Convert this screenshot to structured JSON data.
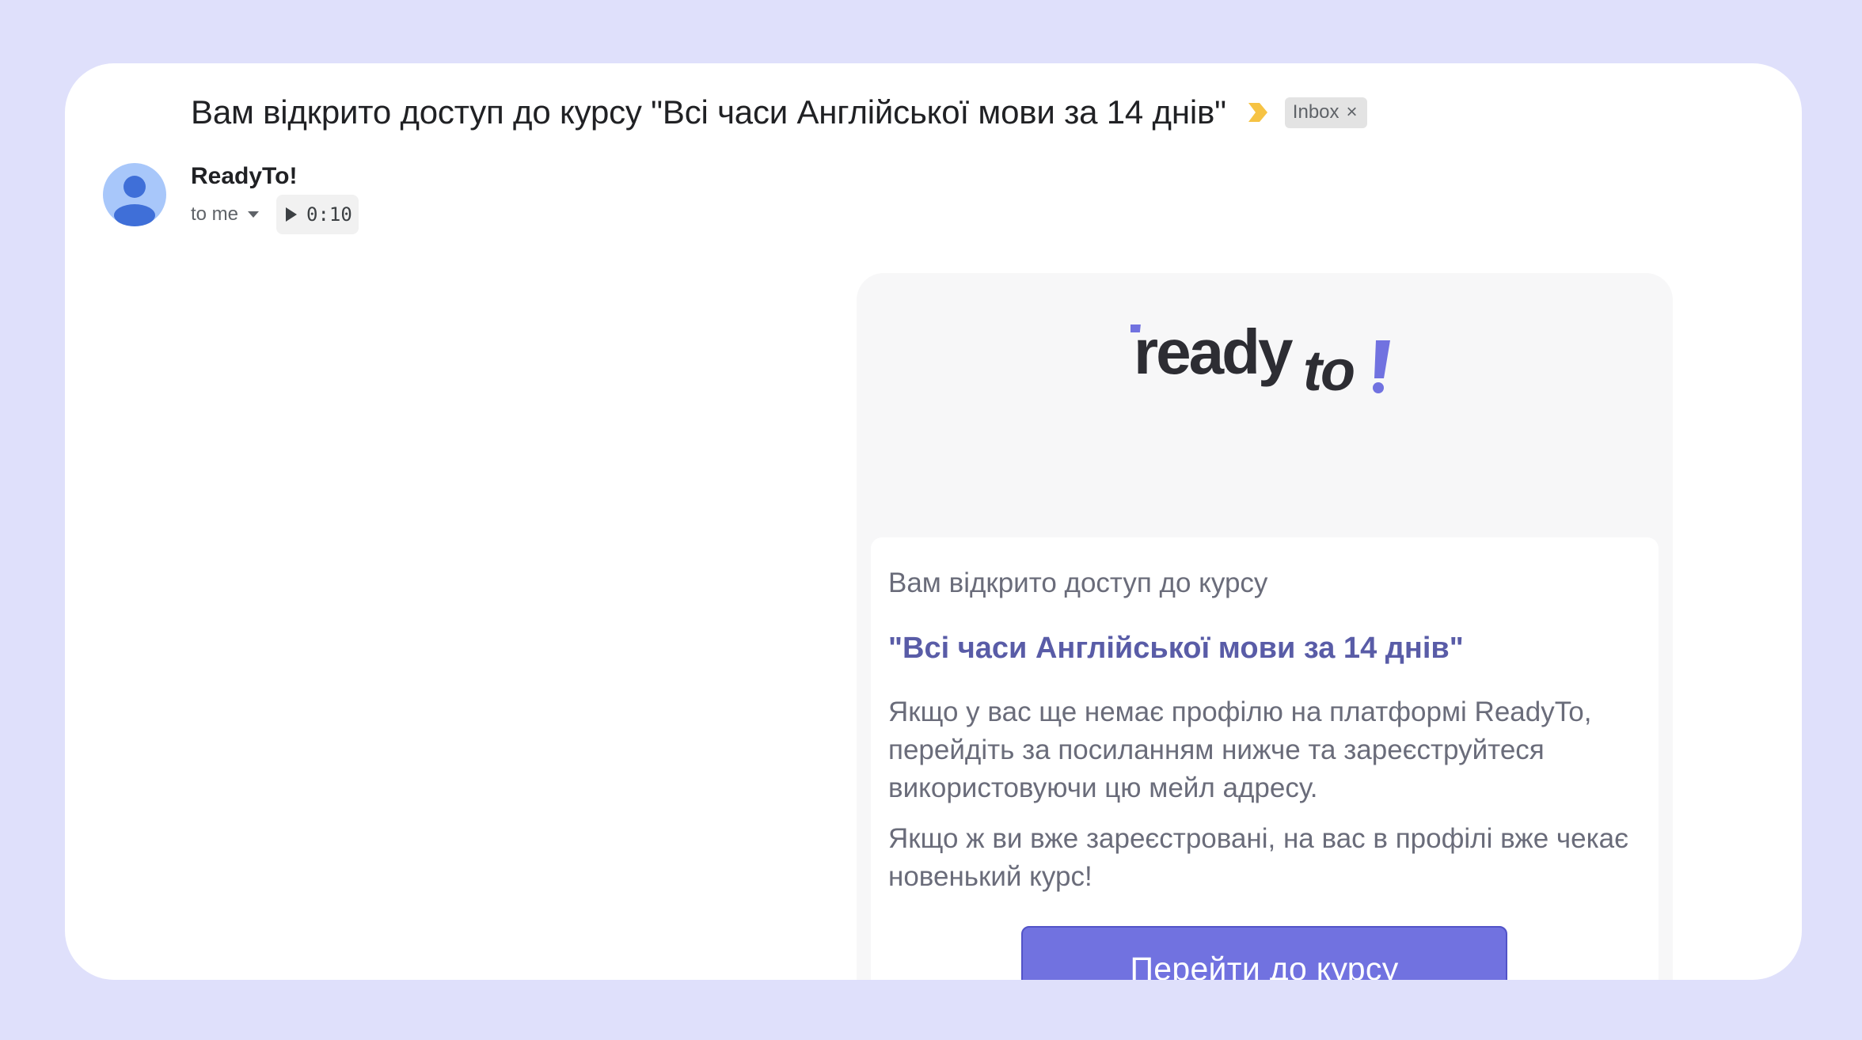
{
  "header": {
    "subject": "Вам відкрито доступ до курсу \"Всі часи Англійської мови за 14 днів\"",
    "label_chip": "Inbox",
    "label_remove": "×"
  },
  "message": {
    "sender": "ReadyTo!",
    "recipient": "to me",
    "audio_duration": "0:10"
  },
  "email_body": {
    "logo_text_main": "ready",
    "logo_text_secondary": "to",
    "intro": "Вам відкрито доступ до курсу",
    "course_title": "\"Всі часи Англійської мови за 14 днів\"",
    "paragraph_1": "Якщо у вас ще немає профілю на платформі ReadyTo, перейдіть за посиланням нижче та зареєструйтеся використовуючи цю мейл адресу.",
    "paragraph_2": "Якщо ж ви вже зареєстровані, на вас в профілі вже чекає новенький курс!",
    "cta_label": "Перейти до курсу"
  },
  "colors": {
    "page_background": "#dfe0fb",
    "brand_purple": "#7172e0",
    "course_title": "#595ca7",
    "important_marker": "#f6c344",
    "avatar": "#a8c7fa"
  },
  "icons": {
    "important": "important-marker-icon",
    "avatar": "person-icon",
    "caret": "caret-down-icon",
    "play": "play-icon"
  }
}
